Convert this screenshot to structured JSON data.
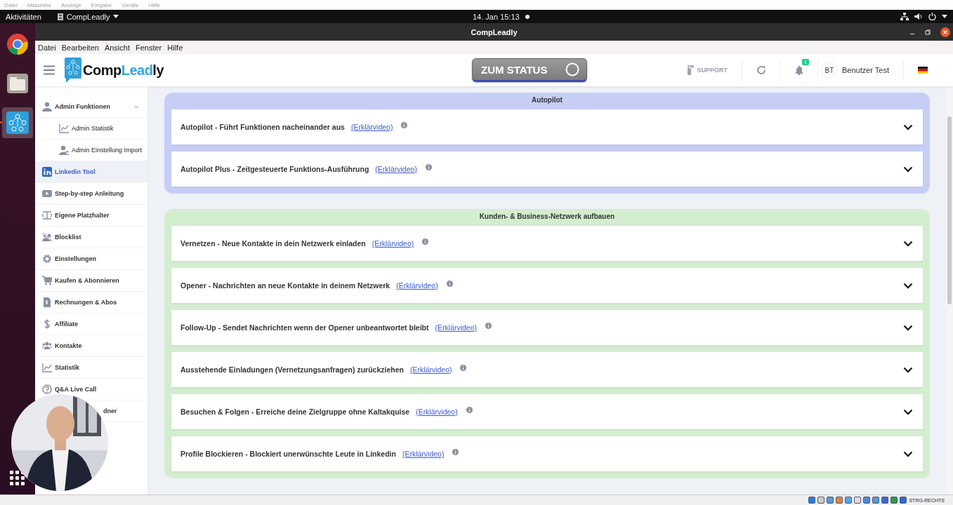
{
  "vm_menu": [
    "Datei",
    "Maschine",
    "Anzeige",
    "Eingabe",
    "Geräte",
    "Hilfe"
  ],
  "top_bar": {
    "activities": "Aktivitäten",
    "app": "CompLeadly",
    "clock": "14. Jan  15:13"
  },
  "dock": [
    {
      "kind": "browser",
      "selected": false
    },
    {
      "kind": "files",
      "selected": false
    },
    {
      "kind": "app",
      "selected": true
    }
  ],
  "window": {
    "title": "CompLeadly"
  },
  "menu_bar": [
    "Datei",
    "Bearbeiten",
    "Ansicht",
    "Fenster",
    "Hilfe"
  ],
  "header": {
    "logo": [
      {
        "text": "Comp",
        "color": "#111111"
      },
      {
        "text": "Lead",
        "color": "#35a4dc"
      },
      {
        "text": "ly",
        "color": "#111111"
      }
    ],
    "status_button": "ZUM STATUS",
    "support": "SUPPORT",
    "notification_count": "1",
    "user": {
      "initials": "BT",
      "name": "Benutzer Test"
    }
  },
  "sidebar": [
    {
      "kind": "group",
      "label": "Admin Funktionen",
      "selected": false,
      "expanded": true,
      "children": [
        {
          "label": "Admin Statistik",
          "selected": false
        },
        {
          "label": "Admin Einstellung Import",
          "selected": false
        }
      ]
    },
    {
      "kind": "item",
      "label": "Linkedin Tool",
      "selected": true
    },
    {
      "kind": "item",
      "label": "Step-by-step Anleitung",
      "selected": false
    },
    {
      "kind": "item",
      "label": "Eigene Platzhalter",
      "selected": false
    },
    {
      "kind": "item",
      "label": "Blocklist",
      "selected": false
    },
    {
      "kind": "item",
      "label": "Einstellungen",
      "selected": false
    },
    {
      "kind": "item",
      "label": "Kaufen & Abonnieren",
      "selected": false
    },
    {
      "kind": "item",
      "label": "Rechnungen & Abos",
      "selected": false
    },
    {
      "kind": "item",
      "label": "Affiliate",
      "selected": false
    },
    {
      "kind": "item",
      "label": "Kontakte",
      "selected": false
    },
    {
      "kind": "item",
      "label": "Statistik",
      "selected": false
    },
    {
      "kind": "item",
      "label": "Q&A Live Call",
      "selected": false
    },
    {
      "kind": "covered",
      "label": "dner",
      "selected": false
    }
  ],
  "panels": [
    {
      "title": "Autopilot",
      "color": "#c6cef6",
      "rows": [
        {
          "text": "Autopilot - Führt Funktionen nacheinander aus",
          "link": "(Erklärvideo)",
          "expanded": false
        },
        {
          "text": "Autopilot Plus - Zeitgesteuerte Funktions-Ausführung",
          "link": "(Erklärvideo)",
          "expanded": false
        }
      ]
    },
    {
      "title": "Kunden- & Business-Netzwerk aufbauen",
      "color": "#d3edcf",
      "rows": [
        {
          "text": "Vernetzen - Neue Kontakte in dein Netzwerk einladen",
          "link": "(Erklärvideo)",
          "expanded": false
        },
        {
          "text": "Opener - Nachrichten an neue Kontakte in deinem Netzwerk",
          "link": "(Erklärvideo)",
          "expanded": false
        },
        {
          "text": "Follow-Up - Sendet Nachrichten wenn der Opener unbeantwortet bleibt",
          "link": "(Erklärvideo)",
          "expanded": false
        },
        {
          "text": "Ausstehende Einladungen (Vernetzungsanfragen) zurückziehen",
          "link": "(Erklärvideo)",
          "expanded": false
        },
        {
          "text": "Besuchen & Folgen - Erreiche deine Zielgruppe ohne Kaltakquise",
          "link": "(Erklärvideo)",
          "expanded": false
        },
        {
          "text": "Profile Blockieren - Blockiert unerwünschte Leute in Linkedin",
          "link": "(Erklärvideo)",
          "expanded": false
        }
      ]
    }
  ],
  "webcam": {
    "kind": "picture"
  },
  "status_bar": {
    "host_key": "STRG-RECHTS"
  }
}
